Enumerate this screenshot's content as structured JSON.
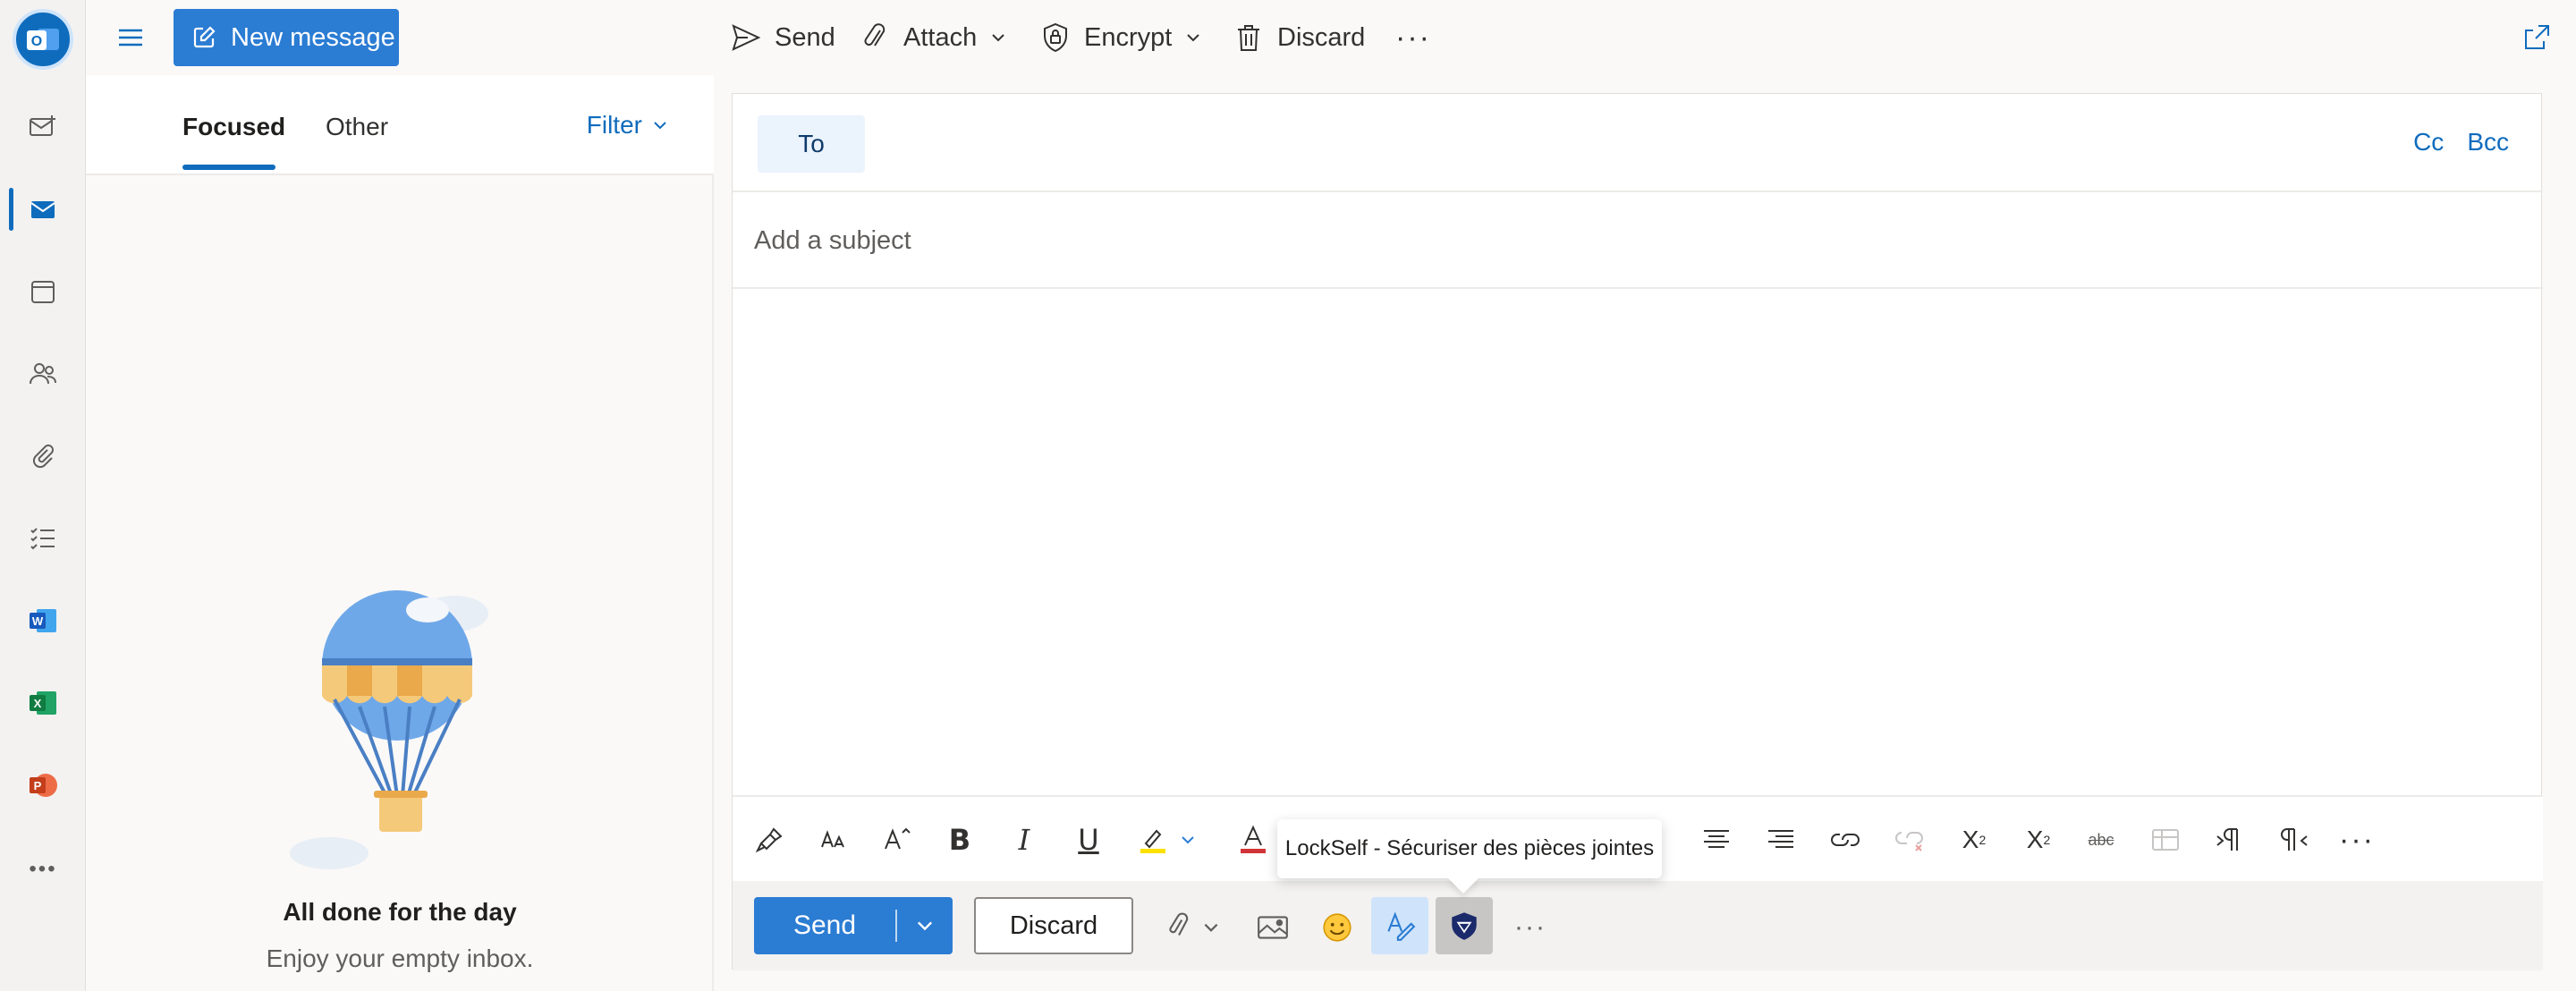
{
  "rail": {
    "items": [
      {
        "name": "new-mail-icon"
      },
      {
        "name": "mail-icon",
        "active": true
      },
      {
        "name": "calendar-icon"
      },
      {
        "name": "people-icon"
      },
      {
        "name": "attachment-icon"
      },
      {
        "name": "todo-icon"
      },
      {
        "name": "word-icon",
        "letter": "W"
      },
      {
        "name": "excel-icon",
        "letter": "X"
      },
      {
        "name": "powerpoint-icon",
        "letter": "P"
      },
      {
        "name": "more-apps-icon",
        "glyph": "•••"
      }
    ],
    "logo_letter": "O"
  },
  "topbar": {
    "new_message": "New message",
    "send": "Send",
    "attach": "Attach",
    "encrypt": "Encrypt",
    "discard": "Discard",
    "more": "···"
  },
  "list": {
    "tabs": [
      {
        "label": "Focused",
        "active": true
      },
      {
        "label": "Other",
        "active": false
      }
    ],
    "filter": "Filter",
    "empty_title": "All done for the day",
    "empty_sub": "Enjoy your empty inbox."
  },
  "compose": {
    "to_label": "To",
    "cc": "Cc",
    "bcc": "Bcc",
    "subject_placeholder": "Add a subject",
    "send": "Send",
    "discard": "Discard",
    "more": "···",
    "format_more": "···"
  },
  "tooltip": {
    "text": "LockSelf - Sécuriser des pièces jointes"
  },
  "colors": {
    "accent": "#2b7cd3",
    "brand": "#0f6cbd",
    "word": "#185abd",
    "excel": "#107c41",
    "powerpoint": "#c43e1c"
  }
}
